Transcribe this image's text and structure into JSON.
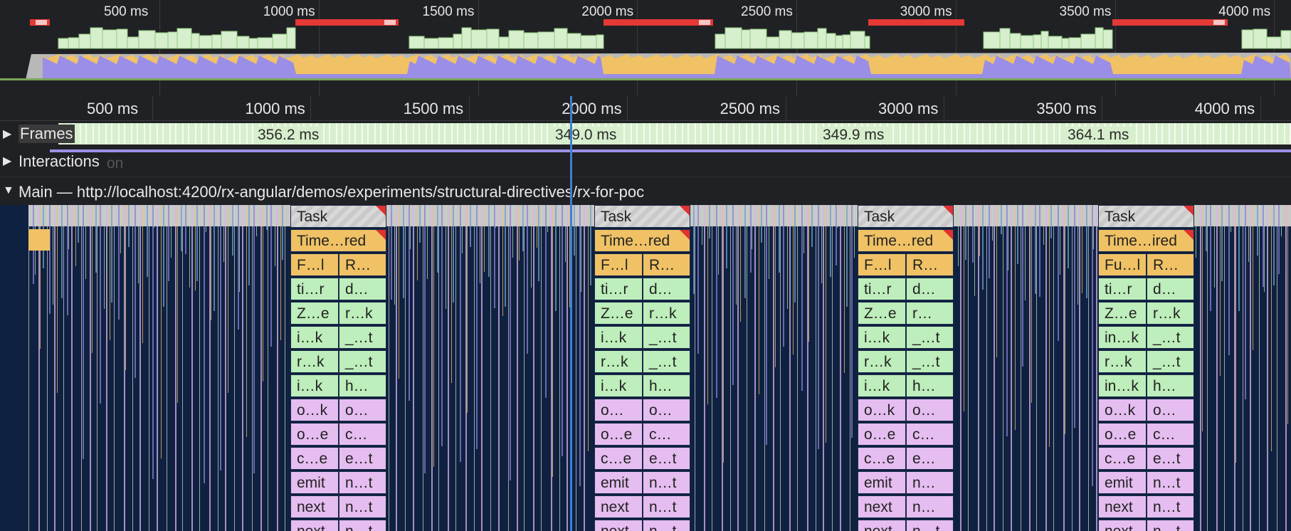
{
  "overview": {
    "ticks": [
      {
        "ms": 500,
        "label": "500 ms"
      },
      {
        "ms": 1000,
        "label": "1000 ms"
      },
      {
        "ms": 1500,
        "label": "1500 ms"
      },
      {
        "ms": 2000,
        "label": "2000 ms"
      },
      {
        "ms": 2500,
        "label": "2500 ms"
      },
      {
        "ms": 3000,
        "label": "3000 ms"
      },
      {
        "ms": 3500,
        "label": "3500 ms"
      },
      {
        "ms": 4000,
        "label": "4000 ms"
      }
    ],
    "long_task_color": "#e53935",
    "frames_color": "#d7efcd",
    "scripting_color": "#f0c265",
    "rendering_color": "#9b8ee6",
    "idle_color": "#b8b8b8"
  },
  "ruler": {
    "ticks": [
      {
        "ms": 500,
        "label": "500 ms"
      },
      {
        "ms": 1000,
        "label": "1000 ms"
      },
      {
        "ms": 1500,
        "label": "1500 ms"
      },
      {
        "ms": 2000,
        "label": "2000 ms"
      },
      {
        "ms": 2500,
        "label": "2500 ms"
      },
      {
        "ms": 3000,
        "label": "3000 ms"
      },
      {
        "ms": 3500,
        "label": "3500 ms"
      },
      {
        "ms": 4000,
        "label": "4000 ms"
      }
    ]
  },
  "tracks": {
    "frames": {
      "toggle": "▶",
      "title": "Frames",
      "durations": [
        "356.2 ms",
        "349.0 ms",
        "349.9 ms",
        "364.1 ms"
      ]
    },
    "interactions": {
      "toggle": "▶",
      "title": "Interactions",
      "ghost": "on"
    },
    "main": {
      "toggle": "▼",
      "title": "Main — http://localhost:4200/rx-angular/demos/experiments/structural-directives/rx-for-poc"
    }
  },
  "flame": {
    "groups": [
      {
        "task": "Task",
        "timer": "Time…red",
        "left": [
          "F…l",
          "ti…r",
          "Z…e",
          "i…k",
          "r…k",
          "i…k",
          "o…k",
          "o…e",
          "c…e",
          "emit",
          "next",
          "next"
        ],
        "right": [
          "R…",
          "d…",
          "r…k",
          "_…t",
          "_…t",
          "h…",
          "o…",
          "c…",
          "e…t",
          "n…t",
          "n…t",
          "n…t"
        ]
      },
      {
        "task": "Task",
        "timer": "Time…red",
        "left": [
          "F…l",
          "ti…r",
          "Z…e",
          "i…k",
          "r…k",
          "i…k",
          "o…",
          "o…e",
          "c…e",
          "emit",
          "next",
          "next"
        ],
        "right": [
          "R…",
          "d…",
          "r…k",
          "_…t",
          "_…t",
          "h…",
          "o…",
          "c…",
          "e…t",
          "n…t",
          "n…t",
          "n…t"
        ]
      },
      {
        "task": "Task",
        "timer": "Time…red",
        "left": [
          "F…l",
          "ti…r",
          "Z…e",
          "i…k",
          "r…k",
          "i…k",
          "o…k",
          "o…e",
          "c…e",
          "emit",
          "next",
          "next"
        ],
        "right": [
          "R…",
          "d…",
          "r…",
          "_…t",
          "_…t",
          "h…",
          "o…",
          "c…",
          "e…",
          "n…",
          "n…",
          "n…t"
        ]
      },
      {
        "task": "Task",
        "timer": "Time…ired",
        "left": [
          "Fu…l",
          "ti…r",
          "Z…e",
          "in…k",
          "r…k",
          "in…k",
          "o…k",
          "o…e",
          "c…e",
          "emit",
          "next",
          "next"
        ],
        "right": [
          "R…",
          "d…",
          "r…k",
          "_…t",
          "_…t",
          "h…",
          "o…",
          "c…",
          "e…t",
          "n…t",
          "n…t",
          "n…t"
        ]
      }
    ],
    "left_row_types": [
      "timer",
      "green",
      "green",
      "green",
      "green",
      "green",
      "purple",
      "purple",
      "purple",
      "purple",
      "purple",
      "purple"
    ]
  }
}
